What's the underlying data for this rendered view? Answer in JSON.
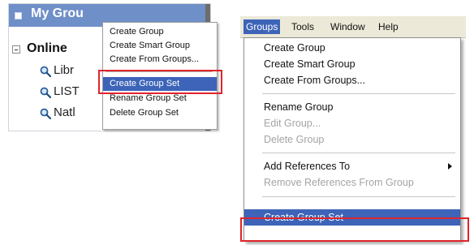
{
  "left": {
    "panel_title": "My Grou",
    "tree_root_label": "Online",
    "tree_items": [
      "Libr",
      "LIST",
      "Natl"
    ],
    "context_menu": [
      "Create Group",
      "Create Smart Group",
      "Create From Groups...",
      "Create Group Set",
      "Rename Group Set",
      "Delete Group Set"
    ],
    "highlighted_item": "Create Group Set"
  },
  "right": {
    "menubar": [
      "Groups",
      "Tools",
      "Window",
      "Help"
    ],
    "active_menu": "Groups",
    "dropdown": {
      "section1": [
        "Create Group",
        "Create Smart Group",
        "Create From Groups..."
      ],
      "section2": [
        "Rename Group",
        "Edit Group...",
        "Delete Group"
      ],
      "section3": [
        "Add References To",
        "Remove References From Group"
      ],
      "section4": [
        "Create Group Set"
      ]
    },
    "disabled_items": [
      "Edit Group...",
      "Delete Group",
      "Remove References From Group"
    ],
    "highlighted_item": "Create Group Set"
  },
  "colors": {
    "highlight": "#3d64b8",
    "callout": "#e0242a",
    "title_bar": "#6f8fc8",
    "menubar_bg": "#ece9d8",
    "disabled_text": "#a4a4a4"
  },
  "icons": [
    "magnifier-icon",
    "tree-collapse-icon",
    "submenu-arrow-icon"
  ]
}
